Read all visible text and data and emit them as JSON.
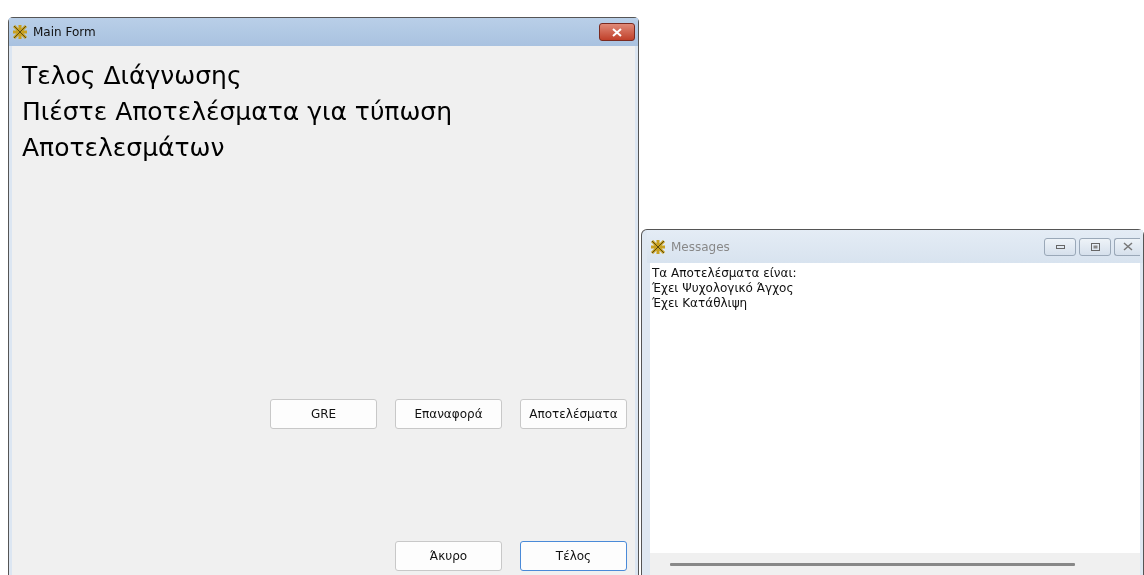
{
  "main_form": {
    "title": "Main Form",
    "active": true,
    "message_lines": [
      "Τελος Διάγνωσης",
      "Πιέστε Αποτελέσματα για τύπωση",
      "Αποτελεσμάτων"
    ],
    "button_rows": [
      [
        {
          "label": "GRE",
          "focused": false
        },
        {
          "label": "Επαναφορά",
          "focused": false
        },
        {
          "label": "Αποτελέσματα",
          "focused": false
        }
      ],
      [
        {
          "label": "Άκυρο",
          "focused": false
        },
        {
          "label": "Τέλος",
          "focused": true
        }
      ]
    ]
  },
  "messages_window": {
    "title": "Messages",
    "active": false,
    "lines": [
      "Τα Αποτελέσματα είναι:",
      "Έχει Ψυχολογικό Άγχος",
      "Έχει Κατάθλιψη"
    ]
  }
}
